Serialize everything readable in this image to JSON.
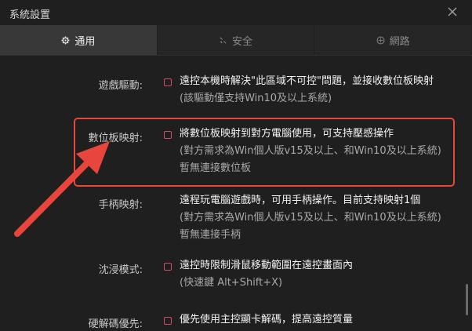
{
  "window": {
    "title": "系統設置"
  },
  "tabs": [
    {
      "label": "通用",
      "icon": "gear-icon",
      "active": true
    },
    {
      "label": "安全",
      "icon": "shield-icon",
      "active": false
    },
    {
      "label": "網路",
      "icon": "globe-icon",
      "active": false
    }
  ],
  "settings": {
    "game_driver": {
      "label": "遊戲驅動:",
      "checked": false,
      "text": "遠控本機時解決\"此區域不可控\"問題，並接收數位板映射",
      "note": "(該驅動僅支持Win10及以上系統)"
    },
    "tablet_mapping": {
      "label": "數位板映射:",
      "checked": false,
      "text": "將數位板映射到對方電腦使用，可支持壓感操作",
      "note": "(對方需求為Win個人版v15及以上、和Win10及以上系統)",
      "status": "暫無連接數位板"
    },
    "gamepad_mapping": {
      "label": "手柄映射:",
      "text": "遠程玩電腦遊戲時，可用手柄操作。目前支持映射1個",
      "note": "(對方需求為Win個人版v15及以上、和Win10及以上系統)",
      "status": "暫無連接手柄"
    },
    "immersive_mode": {
      "label": "沈浸模式:",
      "checked": false,
      "text": "遠控時限制滑鼠移動範圍在遠控畫面內",
      "note": "(快速鍵 Alt+Shift+X)"
    },
    "hw_decode": {
      "label": "硬解碼優先:",
      "checked": false,
      "text": "優先使用主控顯卡解碼，提高遠控質量"
    }
  },
  "colors": {
    "checkbox_border": "#d14b6a",
    "annotation_red": "#e8453c",
    "active_tab_bg": "#383838"
  }
}
